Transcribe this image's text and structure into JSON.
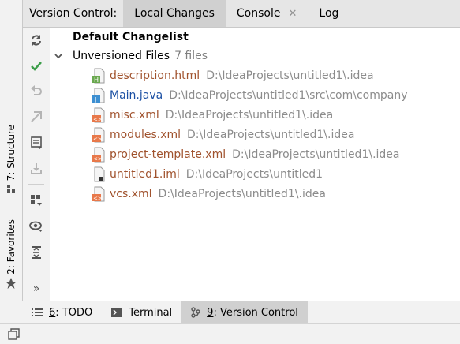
{
  "header": {
    "title": "Version Control:",
    "tabs": [
      {
        "label": "Local Changes",
        "active": true
      },
      {
        "label": "Console",
        "closable": true
      },
      {
        "label": "Log"
      }
    ],
    "close_glyph": "✕"
  },
  "left_stripe": {
    "structure": {
      "mnemonic": "7",
      "label": ": Structure"
    },
    "favorites": {
      "mnemonic": "2",
      "label": ": Favorites"
    },
    "more_glyph": "»"
  },
  "toolbar": {
    "icons": [
      "refresh-icon",
      "commit-check-icon",
      "rollback-icon",
      "merge-icon",
      "changelist-icon",
      "shelve-icon",
      "group-by-icon",
      "view-options-icon",
      "expand-all-icon"
    ]
  },
  "tree": {
    "changelist": "Default Changelist",
    "unversioned": {
      "label": "Unversioned Files",
      "count": "7 files"
    },
    "files": [
      {
        "name": "description.html",
        "path": "D:\\IdeaProjects\\untitled1\\.idea",
        "kind": "html"
      },
      {
        "name": "Main.java",
        "path": "D:\\IdeaProjects\\untitled1\\src\\com\\company",
        "kind": "java"
      },
      {
        "name": "misc.xml",
        "path": "D:\\IdeaProjects\\untitled1\\.idea",
        "kind": "xml"
      },
      {
        "name": "modules.xml",
        "path": "D:\\IdeaProjects\\untitled1\\.idea",
        "kind": "xml"
      },
      {
        "name": "project-template.xml",
        "path": "D:\\IdeaProjects\\untitled1\\.idea",
        "kind": "xml"
      },
      {
        "name": "untitled1.iml",
        "path": "D:\\IdeaProjects\\untitled1",
        "kind": "iml"
      },
      {
        "name": "vcs.xml",
        "path": "D:\\IdeaProjects\\untitled1\\.idea",
        "kind": "xml"
      }
    ]
  },
  "bottom_tabs": [
    {
      "mnemonic": "6",
      "label": ": TODO",
      "icon": "todo-list-icon"
    },
    {
      "mnemonic": "",
      "label": "Terminal",
      "icon": "terminal-icon"
    },
    {
      "mnemonic": "9",
      "label": ": Version Control",
      "icon": "version-control-icon",
      "active": true
    }
  ],
  "colors": {
    "file_link": "#a0522d",
    "java_link": "#1a4fa3",
    "path_gray": "#8c8c8c",
    "xml_badge": "#e8784a",
    "html_badge": "#6aa84f",
    "java_badge": "#3d8fd1"
  }
}
